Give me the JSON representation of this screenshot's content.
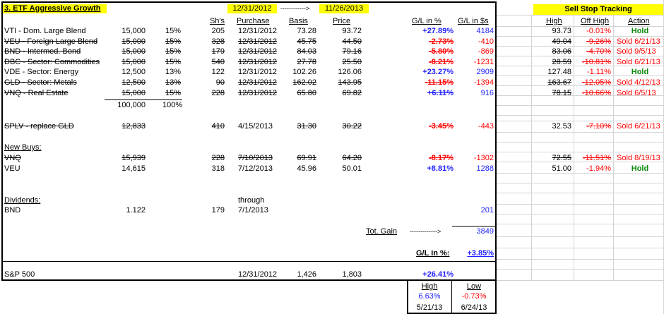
{
  "title": "3. ETF Aggressive Growth",
  "header": {
    "date_start": "12/31/2012",
    "arrow": "------------>",
    "date_end": "11/26/2013",
    "col_shares": "Sh's",
    "col_purchase": "Purchase",
    "col_basis": "Basis",
    "col_price": "Price",
    "col_gl_pct": "G/L in %",
    "col_gl_usd": "G/L in $s"
  },
  "sst": {
    "title": "Sell Stop Tracking",
    "col_high": "High",
    "col_off_high": "Off High",
    "col_action": "Action"
  },
  "holdings": [
    {
      "name": "VTI - Dom. Large Blend",
      "amount": "15,000",
      "pct": "15%",
      "shares": "205",
      "purchase": "12/31/2012",
      "basis": "73.28",
      "price": "93.72",
      "gl_pct": "+27.89%",
      "gl_usd": "4184",
      "high": "93.73",
      "off_high": "-0.01%",
      "action": "Hold",
      "sold": false
    },
    {
      "name": "VEU - Foreign Large Blend",
      "amount": "15,000",
      "pct": "15%",
      "shares": "328",
      "purchase": "12/31/2012",
      "basis": "45.75",
      "price": "44.50",
      "gl_pct": "-2.73%",
      "gl_usd": "-410",
      "high": "49.04",
      "off_high": "-9.26%",
      "action": "Sold 6/21/13",
      "sold": true
    },
    {
      "name": "BND - Intermed. Bond",
      "amount": "15,000",
      "pct": "15%",
      "shares": "179",
      "purchase": "12/31/2012",
      "basis": "84.03",
      "price": "79.16",
      "gl_pct": "-5.80%",
      "gl_usd": "-869",
      "high": "83.06",
      "off_high": "-4.70%",
      "action": "Sold 9/5/13",
      "sold": true
    },
    {
      "name": "DBC - Sector: Commodities",
      "amount": "15,000",
      "pct": "15%",
      "shares": "540",
      "purchase": "12/31/2012",
      "basis": "27.78",
      "price": "25.50",
      "gl_pct": "-8.21%",
      "gl_usd": "-1231",
      "high": "28.59",
      "off_high": "-10.81%",
      "action": "Sold 6/21/13",
      "sold": true
    },
    {
      "name": "VDE - Sector: Energy",
      "amount": "12,500",
      "pct": "13%",
      "shares": "122",
      "purchase": "12/31/2012",
      "basis": "102.26",
      "price": "126.06",
      "gl_pct": "+23.27%",
      "gl_usd": "2909",
      "high": "127.48",
      "off_high": "-1.11%",
      "action": "Hold",
      "sold": false
    },
    {
      "name": "GLD - Sector: Metals",
      "amount": "12,500",
      "pct": "13%",
      "shares": "90",
      "purchase": "12/31/2012",
      "basis": "162.02",
      "price": "143.95",
      "gl_pct": "-11.15%",
      "gl_usd": "-1394",
      "high": "163.67",
      "off_high": "-12.05%",
      "action": "Sold 4/12/13",
      "sold": true
    },
    {
      "name": "VNQ - Real Estate",
      "amount": "15,000",
      "pct": "15%",
      "shares": "228",
      "purchase": "12/31/2012",
      "basis": "65.80",
      "price": "69.82",
      "gl_pct": "+6.11%",
      "gl_usd": "916",
      "high": "78.15",
      "off_high": "-10.66%",
      "action": "Sold 6/5/13",
      "sold": true
    }
  ],
  "totals": {
    "amount": "100,000",
    "pct": "100%"
  },
  "splv": {
    "name": "SPLV - replace GLD",
    "amount": "12,833",
    "shares": "410",
    "purchase": "4/15/2013",
    "basis": "31.30",
    "price": "30.22",
    "gl_pct": "-3.45%",
    "gl_usd": "-443",
    "high": "32.53",
    "off_high": "-7.10%",
    "action": "Sold 6/21/13"
  },
  "new_buys_label": "New Buys:",
  "new_buys": [
    {
      "name": "VNQ",
      "amount": "15,939",
      "shares": "228",
      "purchase": "7/10/2013",
      "basis": "69.91",
      "price": "64.20",
      "gl_pct": "-8.17%",
      "gl_usd": "-1302",
      "high": "72.55",
      "off_high": "-11.51%",
      "action": "Sold 8/19/13",
      "sold": true
    },
    {
      "name": "VEU",
      "amount": "14,615",
      "shares": "318",
      "purchase": "7/12/2013",
      "basis": "45.96",
      "price": "50.01",
      "gl_pct": "+8.81%",
      "gl_usd": "1288",
      "high": "51.00",
      "off_high": "-1.94%",
      "action": "Hold",
      "sold": false
    }
  ],
  "dividends": {
    "label": "Dividends:",
    "through_label": "through",
    "name": "BND",
    "amount": "1.122",
    "shares": "179",
    "date": "7/1/2013",
    "gl_usd": "201"
  },
  "summary": {
    "tot_gain_label": "Tot. Gain",
    "tot_gain_arrow": "------------->",
    "tot_gain_value": "3849",
    "gl_pct_label": "G/L in %:",
    "gl_pct_value": "+3.85%"
  },
  "sp500": {
    "name": "S&P 500",
    "date": "12/31/2012",
    "basis": "1,426",
    "price": "1,803",
    "gl_pct": "+26.41%"
  },
  "hilo": {
    "high_label": "High",
    "low_label": "Low",
    "high_value": "6.63%",
    "low_value": "-0.73%",
    "high_date": "5/21/13",
    "low_date": "6/24/13"
  },
  "colors": {
    "highlight": "#ffff00",
    "negative": "#ff0000",
    "positive": "#1f1fff",
    "hold": "#0a8a0a"
  }
}
